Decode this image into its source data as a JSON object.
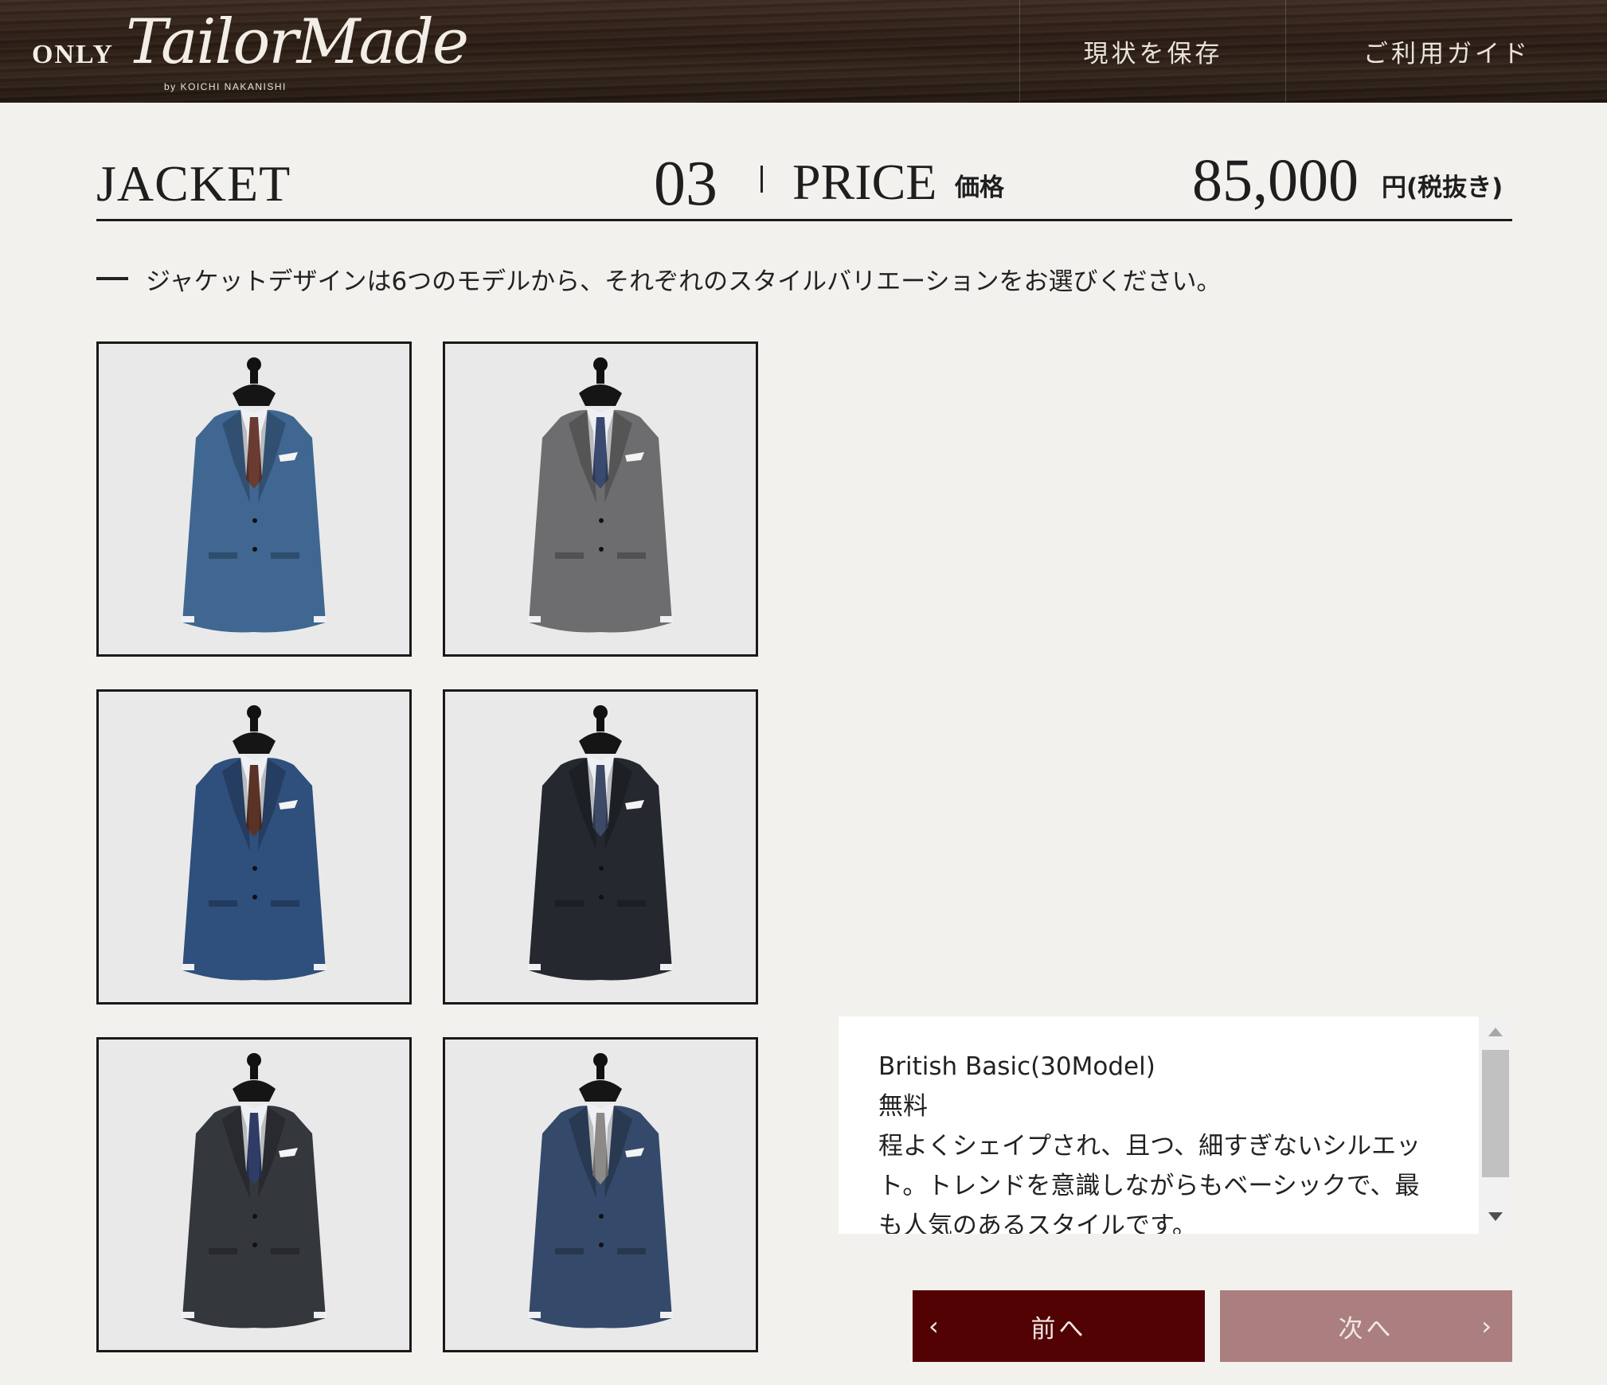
{
  "header": {
    "logo": {
      "only": "ONLY",
      "script": "TailorMade",
      "by": "by KOICHI NAKANISHI"
    },
    "nav": {
      "save": "現状を保存",
      "guide": "ご利用ガイド"
    }
  },
  "title_bar": {
    "section": "JACKET",
    "step": "03",
    "price_label": "PRICE",
    "price_label_jp": "価格",
    "price_value": "85,000",
    "price_unit": "円(税抜き)"
  },
  "instruction": "ジャケットデザインは6つのモデルから、それぞれのスタイルバリエーションをお選びください。",
  "models": [
    {
      "icon": "jacket-blue-pinstripe-photo",
      "jacket_color": "#3f6791",
      "tie_color": "#6a3b30"
    },
    {
      "icon": "jacket-grey-herringbone-photo",
      "jacket_color": "#6d6d6f",
      "tie_color": "#3a4a6e"
    },
    {
      "icon": "jacket-navy-stripe-photo",
      "jacket_color": "#2f4f7c",
      "tie_color": "#5a3326"
    },
    {
      "icon": "jacket-charcoal-grey-photo",
      "jacket_color": "#25282f",
      "tie_color": "#3d4a66"
    },
    {
      "icon": "jacket-windowpane-check-photo",
      "jacket_color": "#34373b",
      "tie_color": "#2f3d66"
    },
    {
      "icon": "jacket-blue-black-photo",
      "jacket_color": "#354a6a",
      "tie_color": "#8c8986"
    }
  ],
  "description": {
    "name": "British Basic(30Model)",
    "price": "無料",
    "body": "程よくシェイプされ、且つ、細すぎないシルエット。トレンドを意識しながらもベーシックで、最も人気のあるスタイルです。"
  },
  "buttons": {
    "prev": "前へ",
    "next": "次へ",
    "prev_arrow": "‹",
    "next_arrow": "›"
  },
  "colors": {
    "header_bg": "#2e2017",
    "page_bg": "#f3f1ee",
    "prev_btn": "#520202",
    "next_btn": "#ab7f7f"
  }
}
